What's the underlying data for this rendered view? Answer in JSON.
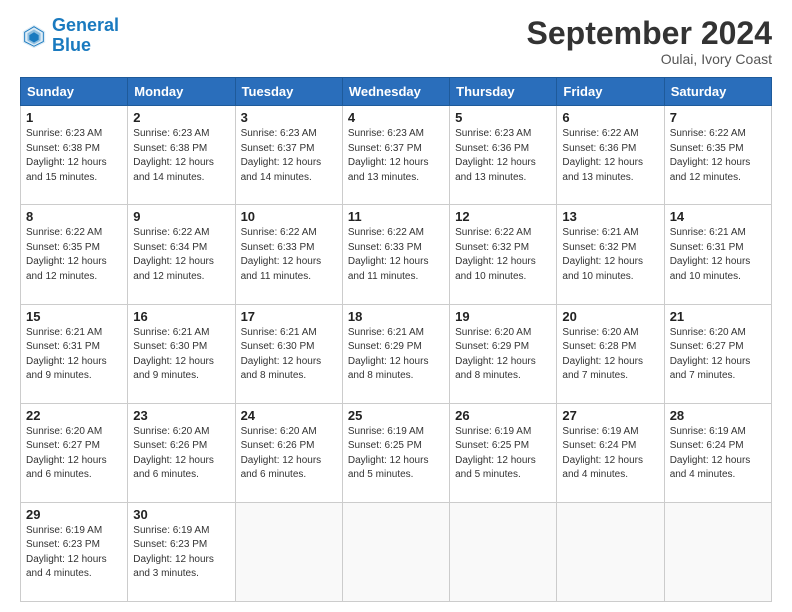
{
  "header": {
    "logo_line1": "General",
    "logo_line2": "Blue",
    "month_title": "September 2024",
    "location": "Oulai, Ivory Coast"
  },
  "weekdays": [
    "Sunday",
    "Monday",
    "Tuesday",
    "Wednesday",
    "Thursday",
    "Friday",
    "Saturday"
  ],
  "weeks": [
    [
      {
        "day": "1",
        "sunrise": "6:23 AM",
        "sunset": "6:38 PM",
        "daylight": "12 hours and 15 minutes."
      },
      {
        "day": "2",
        "sunrise": "6:23 AM",
        "sunset": "6:38 PM",
        "daylight": "12 hours and 14 minutes."
      },
      {
        "day": "3",
        "sunrise": "6:23 AM",
        "sunset": "6:37 PM",
        "daylight": "12 hours and 14 minutes."
      },
      {
        "day": "4",
        "sunrise": "6:23 AM",
        "sunset": "6:37 PM",
        "daylight": "12 hours and 13 minutes."
      },
      {
        "day": "5",
        "sunrise": "6:23 AM",
        "sunset": "6:36 PM",
        "daylight": "12 hours and 13 minutes."
      },
      {
        "day": "6",
        "sunrise": "6:22 AM",
        "sunset": "6:36 PM",
        "daylight": "12 hours and 13 minutes."
      },
      {
        "day": "7",
        "sunrise": "6:22 AM",
        "sunset": "6:35 PM",
        "daylight": "12 hours and 12 minutes."
      }
    ],
    [
      {
        "day": "8",
        "sunrise": "6:22 AM",
        "sunset": "6:35 PM",
        "daylight": "12 hours and 12 minutes."
      },
      {
        "day": "9",
        "sunrise": "6:22 AM",
        "sunset": "6:34 PM",
        "daylight": "12 hours and 12 minutes."
      },
      {
        "day": "10",
        "sunrise": "6:22 AM",
        "sunset": "6:33 PM",
        "daylight": "12 hours and 11 minutes."
      },
      {
        "day": "11",
        "sunrise": "6:22 AM",
        "sunset": "6:33 PM",
        "daylight": "12 hours and 11 minutes."
      },
      {
        "day": "12",
        "sunrise": "6:22 AM",
        "sunset": "6:32 PM",
        "daylight": "12 hours and 10 minutes."
      },
      {
        "day": "13",
        "sunrise": "6:21 AM",
        "sunset": "6:32 PM",
        "daylight": "12 hours and 10 minutes."
      },
      {
        "day": "14",
        "sunrise": "6:21 AM",
        "sunset": "6:31 PM",
        "daylight": "12 hours and 10 minutes."
      }
    ],
    [
      {
        "day": "15",
        "sunrise": "6:21 AM",
        "sunset": "6:31 PM",
        "daylight": "12 hours and 9 minutes."
      },
      {
        "day": "16",
        "sunrise": "6:21 AM",
        "sunset": "6:30 PM",
        "daylight": "12 hours and 9 minutes."
      },
      {
        "day": "17",
        "sunrise": "6:21 AM",
        "sunset": "6:30 PM",
        "daylight": "12 hours and 8 minutes."
      },
      {
        "day": "18",
        "sunrise": "6:21 AM",
        "sunset": "6:29 PM",
        "daylight": "12 hours and 8 minutes."
      },
      {
        "day": "19",
        "sunrise": "6:20 AM",
        "sunset": "6:29 PM",
        "daylight": "12 hours and 8 minutes."
      },
      {
        "day": "20",
        "sunrise": "6:20 AM",
        "sunset": "6:28 PM",
        "daylight": "12 hours and 7 minutes."
      },
      {
        "day": "21",
        "sunrise": "6:20 AM",
        "sunset": "6:27 PM",
        "daylight": "12 hours and 7 minutes."
      }
    ],
    [
      {
        "day": "22",
        "sunrise": "6:20 AM",
        "sunset": "6:27 PM",
        "daylight": "12 hours and 6 minutes."
      },
      {
        "day": "23",
        "sunrise": "6:20 AM",
        "sunset": "6:26 PM",
        "daylight": "12 hours and 6 minutes."
      },
      {
        "day": "24",
        "sunrise": "6:20 AM",
        "sunset": "6:26 PM",
        "daylight": "12 hours and 6 minutes."
      },
      {
        "day": "25",
        "sunrise": "6:19 AM",
        "sunset": "6:25 PM",
        "daylight": "12 hours and 5 minutes."
      },
      {
        "day": "26",
        "sunrise": "6:19 AM",
        "sunset": "6:25 PM",
        "daylight": "12 hours and 5 minutes."
      },
      {
        "day": "27",
        "sunrise": "6:19 AM",
        "sunset": "6:24 PM",
        "daylight": "12 hours and 4 minutes."
      },
      {
        "day": "28",
        "sunrise": "6:19 AM",
        "sunset": "6:24 PM",
        "daylight": "12 hours and 4 minutes."
      }
    ],
    [
      {
        "day": "29",
        "sunrise": "6:19 AM",
        "sunset": "6:23 PM",
        "daylight": "12 hours and 4 minutes."
      },
      {
        "day": "30",
        "sunrise": "6:19 AM",
        "sunset": "6:23 PM",
        "daylight": "12 hours and 3 minutes."
      },
      null,
      null,
      null,
      null,
      null
    ]
  ]
}
